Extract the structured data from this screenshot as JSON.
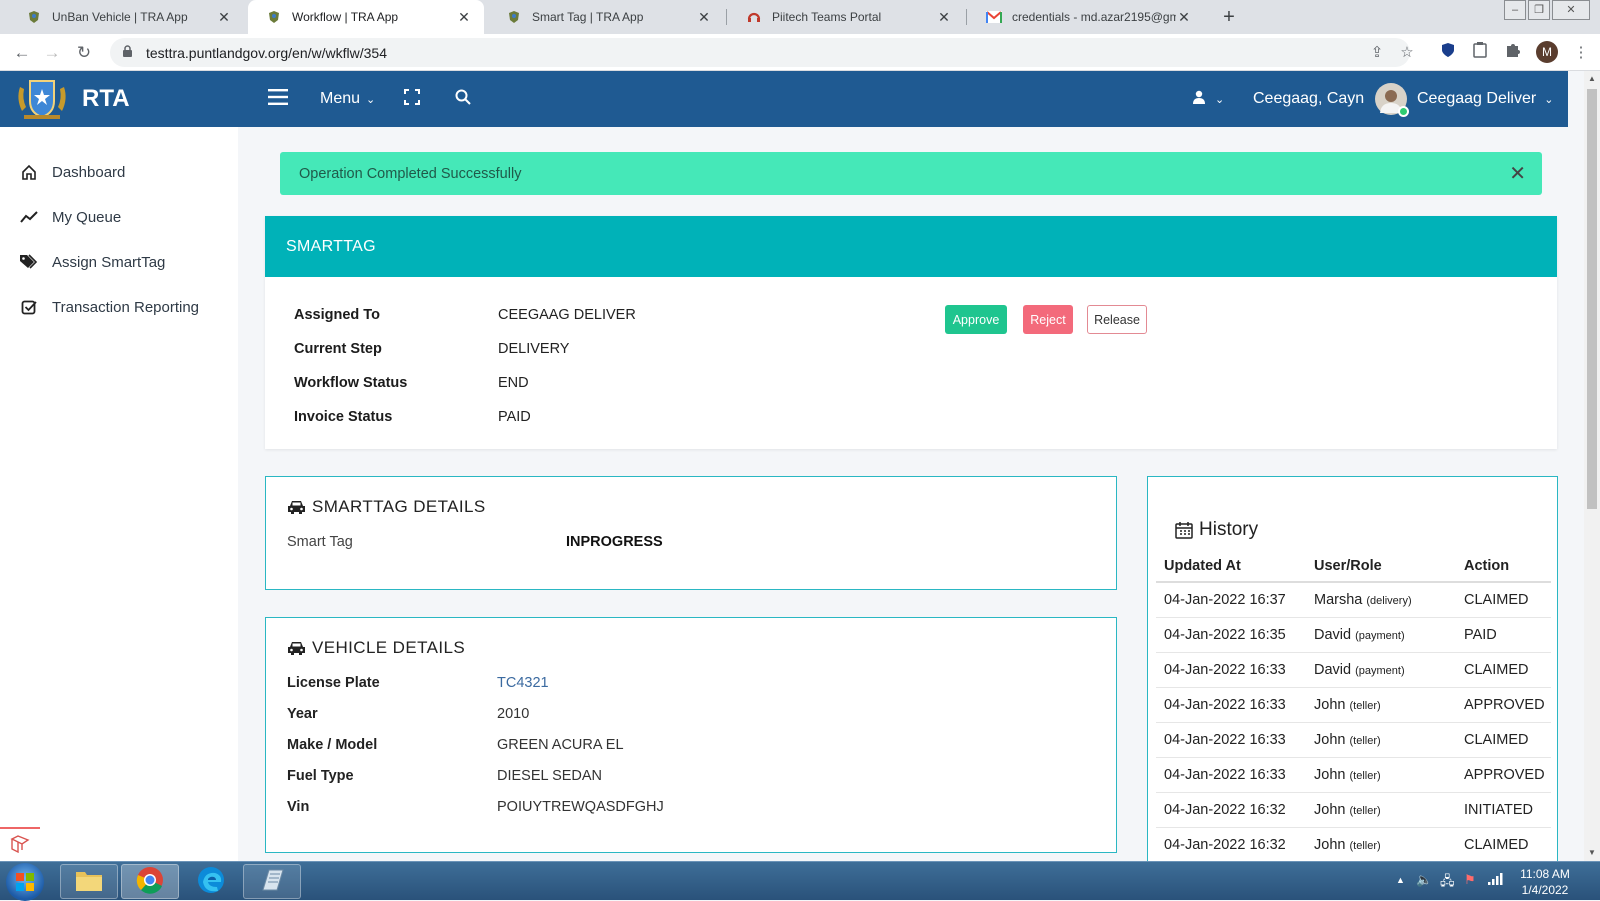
{
  "browser": {
    "tabs": [
      {
        "title": "UnBan Vehicle | TRA App",
        "icon": "rta-crest-icon"
      },
      {
        "title": "Workflow | TRA App",
        "icon": "rta-crest-icon",
        "active": true
      },
      {
        "title": "Smart Tag | TRA App",
        "icon": "rta-crest-icon"
      },
      {
        "title": "Piitech Teams Portal",
        "icon": "headset-icon"
      },
      {
        "title": "credentials - md.azar2195@gmail",
        "icon": "gmail-icon"
      }
    ],
    "url": "testtra.puntlandgov.org/en/w/wkflw/354",
    "profile_initial": "M"
  },
  "header": {
    "brand": "RTA",
    "menu_label": "Menu",
    "location": "Ceegaag, Cayn",
    "user_name": "Ceegaag Deliver"
  },
  "sidebar": {
    "items": [
      {
        "label": "Dashboard",
        "icon": "home-icon"
      },
      {
        "label": "My Queue",
        "icon": "trend-line-icon"
      },
      {
        "label": "Assign SmartTag",
        "icon": "tags-icon"
      },
      {
        "label": "Transaction Reporting",
        "icon": "checkbox-icon"
      }
    ]
  },
  "alert": {
    "message": "Operation Completed Successfully",
    "color": "#45e8b8"
  },
  "smarttag": {
    "title": "SMARTTAG",
    "fields": [
      {
        "label": "Assigned To",
        "value": "CEEGAAG DELIVER"
      },
      {
        "label": "Current Step",
        "value": "DELIVERY"
      },
      {
        "label": "Workflow Status",
        "value": "END"
      },
      {
        "label": "Invoice Status",
        "value": "PAID"
      }
    ],
    "buttons": {
      "approve": "Approve",
      "reject": "Reject",
      "release": "Release"
    }
  },
  "smarttag_details": {
    "title": "SMARTTAG DETAILS",
    "label": "Smart Tag",
    "value": "INPROGRESS"
  },
  "vehicle_details": {
    "title": "VEHICLE DETAILS",
    "fields": [
      {
        "label": "License Plate",
        "value": "TC4321"
      },
      {
        "label": "Year",
        "value": "2010"
      },
      {
        "label": "Make / Model",
        "value": "GREEN ACURA EL"
      },
      {
        "label": "Fuel Type",
        "value": "DIESEL SEDAN"
      },
      {
        "label": "Vin",
        "value": "POIUYTREWQASDFGHJ"
      }
    ]
  },
  "history": {
    "title": "History",
    "columns": [
      "Updated At",
      "User/Role",
      "Action"
    ],
    "rows": [
      {
        "at": "04-Jan-2022 16:37",
        "user": "Marsha",
        "role": "(delivery)",
        "action": "CLAIMED"
      },
      {
        "at": "04-Jan-2022 16:35",
        "user": "David",
        "role": "(payment)",
        "action": "PAID"
      },
      {
        "at": "04-Jan-2022 16:33",
        "user": "David",
        "role": "(payment)",
        "action": "CLAIMED"
      },
      {
        "at": "04-Jan-2022 16:33",
        "user": "John",
        "role": "(teller)",
        "action": "APPROVED"
      },
      {
        "at": "04-Jan-2022 16:33",
        "user": "John",
        "role": "(teller)",
        "action": "CLAIMED"
      },
      {
        "at": "04-Jan-2022 16:33",
        "user": "John",
        "role": "(teller)",
        "action": "APPROVED"
      },
      {
        "at": "04-Jan-2022 16:32",
        "user": "John",
        "role": "(teller)",
        "action": "INITIATED"
      },
      {
        "at": "04-Jan-2022 16:32",
        "user": "John",
        "role": "(teller)",
        "action": "CLAIMED"
      }
    ]
  },
  "taskbar": {
    "time": "11:08 AM",
    "date": "1/4/2022"
  }
}
